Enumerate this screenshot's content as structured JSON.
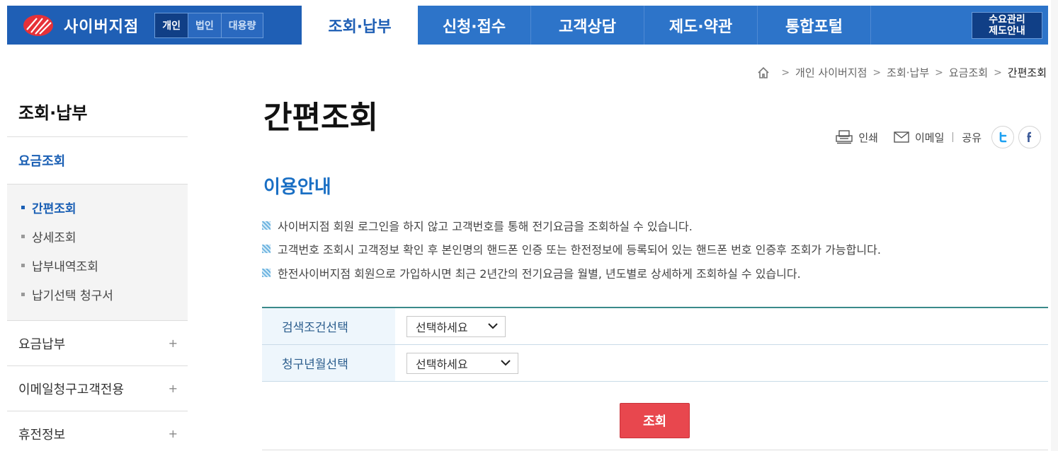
{
  "header": {
    "brand_name": "사이버지점",
    "segments": [
      {
        "label": "개인"
      },
      {
        "label": "법인"
      },
      {
        "label": "대용량"
      }
    ],
    "menu": [
      {
        "label": "조회·납부"
      },
      {
        "label": "신청·접수"
      },
      {
        "label": "고객상담"
      },
      {
        "label": "제도·약관"
      },
      {
        "label": "통합포털"
      }
    ],
    "demand_button": "수요관리\n제도안내"
  },
  "breadcrumb": {
    "items": [
      "개인 사이버지점",
      "조회·납부",
      "요금조회",
      "간편조회"
    ]
  },
  "sidebar": {
    "title": "조회·납부",
    "main_item": "요금조회",
    "sub_items": [
      {
        "label": "간편조회"
      },
      {
        "label": "상세조회"
      },
      {
        "label": "납부내역조회"
      },
      {
        "label": "납기선택 청구서"
      }
    ],
    "groups": [
      {
        "label": "요금납부",
        "icon": "+"
      },
      {
        "label": "이메일청구고객전용",
        "icon": "+"
      },
      {
        "label": "휴전정보",
        "icon": "+"
      }
    ]
  },
  "main": {
    "page_title": "간편조회",
    "tools": {
      "print": "인쇄",
      "email": "이메일",
      "share": "공유"
    },
    "section_title": "이용안내",
    "info": [
      "사이버지점 회원 로그인을 하지 않고 고객번호를 통해 전기요금을 조회하실 수 있습니다.",
      "고객번호 조회시 고객정보 확인 후 본인명의 핸드폰 인증 또는 한전정보에 등록되어 있는 핸드폰 번호 인증후 조회가 가능합니다.",
      "한전사이버지점 회원으로 가입하시면 최근 2년간의 전기요금을 월별, 년도별로 상세하게 조회하실 수 있습니다."
    ],
    "form": {
      "rows": [
        {
          "label": "검색조건선택",
          "value": "선택하세요"
        },
        {
          "label": "청구년월선택",
          "value": "선택하세요"
        }
      ]
    },
    "search_button": "조회"
  },
  "colors": {
    "nav_blue": "#2d74c9",
    "nav_dark": "#103f86",
    "accent_blue": "#1a6fc4",
    "search_red": "#e8474e"
  }
}
